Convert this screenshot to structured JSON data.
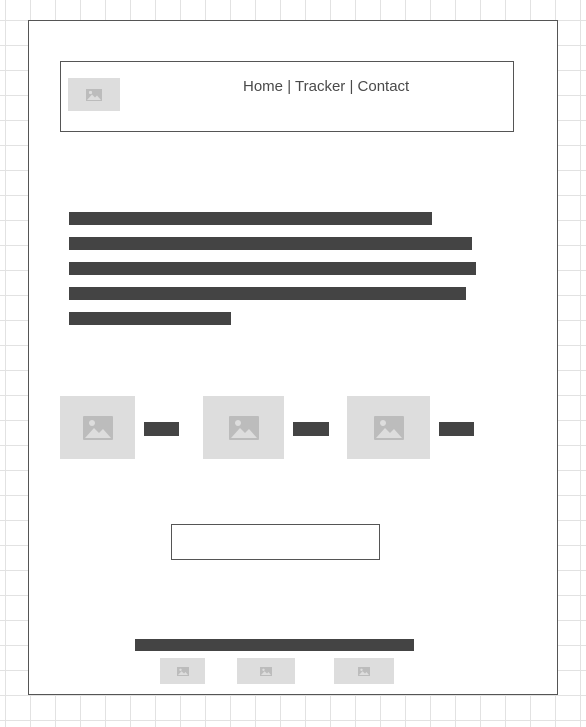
{
  "nav": {
    "items": [
      "Home",
      "Tracker",
      "Contact"
    ],
    "separator": "|"
  },
  "icons": {
    "placeholder": "image-placeholder-icon"
  },
  "colors": {
    "text_block": "#444444",
    "placeholder_fill": "#dddddd",
    "placeholder_icon": "#bcbcbc",
    "border": "#555555"
  }
}
